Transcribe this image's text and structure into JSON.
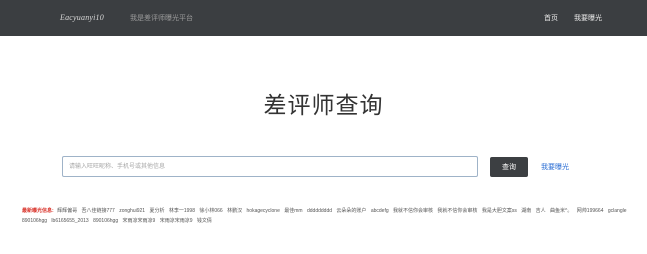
{
  "navbar": {
    "brand": "Eacyuanyi10",
    "subtitle": "我是差评师曝光平台",
    "links": [
      "首页",
      "我要曝光"
    ]
  },
  "main": {
    "title": "差评师查询"
  },
  "search": {
    "placeholder": "请输入旺旺昵称、手机号或其他信息",
    "value": "",
    "button_label": "查询",
    "expose_link": "我要曝光"
  },
  "recent": {
    "label": "最新曝光信息:",
    "names": [
      "辉辉偏哥",
      "吾八佳链接777",
      "zonghui921",
      "夏分析",
      "林李一1998",
      "徐小林066",
      "林鹏汉",
      "hokagecyclone",
      "最佳mm",
      "ddddddddd",
      "云朵朵的账户",
      "abcdefg",
      "我就不信你会审核",
      "我就不信你会审核",
      "我是大胆文案ss",
      "湖南",
      "吉人",
      "曲鱼米^。",
      "网帅199664",
      "gclangle",
      "890106hgg",
      "lb6165655_2013",
      "890106hgg",
      "宋雨凉宋雨凉9",
      "宋雨凉宋雨凉9",
      "钱文倩"
    ]
  }
}
